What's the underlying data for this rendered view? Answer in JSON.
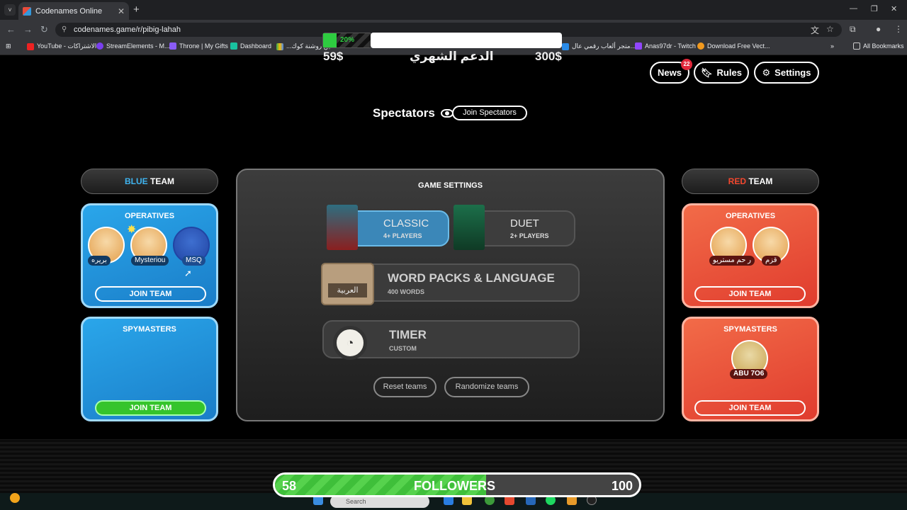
{
  "browser": {
    "tab_title": "Codenames Online",
    "url": "codenames.game/r/pibig-lahah",
    "bookmarks": [
      "YouTube - الاشتراكات",
      "StreamElements - M...",
      "Throne | My Gifts",
      "Dashboard",
      "...مين روشنة كوك",
      "متجر ألعاب رقمي عال...",
      "Anas97dr - Twitch",
      "Download Free Vect..."
    ],
    "all_bookmarks": "All Bookmarks"
  },
  "overlay": {
    "goal_percent": "20%",
    "left_amount": "59$",
    "center_text": "الدعم الشهري",
    "right_amount": "300$"
  },
  "header": {
    "news_label": "News",
    "news_badge": "22",
    "rules_label": "Rules",
    "settings_label": "Settings"
  },
  "spectators": {
    "title": "Spectators",
    "join_label": "Join Spectators"
  },
  "blue_team": {
    "title_color_word": "BLUE",
    "title_word": "TEAM",
    "operatives_title": "OPERATIVES",
    "operatives": [
      "بريره",
      "Mysteriou",
      "MSQ"
    ],
    "join_operatives": "JOIN TEAM",
    "spymasters_title": "SPYMASTERS",
    "join_spymasters": "JOIN TEAM"
  },
  "red_team": {
    "title_color_word": "RED",
    "title_word": "TEAM",
    "operatives_title": "OPERATIVES",
    "operatives": [
      "ر حم مستريو",
      "قزم"
    ],
    "join_operatives": "JOIN TEAM",
    "spymasters_title": "SPYMASTERS",
    "spymasters": [
      "ABU 7O6"
    ],
    "join_spymasters": "JOIN TEAM"
  },
  "game_settings": {
    "title": "GAME SETTINGS",
    "modes": [
      {
        "title": "CLASSIC",
        "subtitle": "4+ PLAYERS",
        "selected": true
      },
      {
        "title": "DUET",
        "subtitle": "2+ PLAYERS",
        "selected": false
      }
    ],
    "word_packs": {
      "title": "WORD PACKS & LANGUAGE",
      "subtitle": "400 WORDS",
      "card_text": "العربية"
    },
    "timer": {
      "title": "TIMER",
      "subtitle": "CUSTOM"
    },
    "reset_label": "Reset teams",
    "randomize_label": "Randomize teams"
  },
  "followers": {
    "current": "58",
    "label": "FOLLOWERS",
    "goal": "100",
    "progress_percent": 58
  },
  "taskbar": {
    "search_placeholder": "Search"
  },
  "colors": {
    "blue_accent": "#3fb4f0",
    "red_accent": "#f2472e",
    "selected_mode": "#3b87b8",
    "join_green": "#35c42c"
  }
}
